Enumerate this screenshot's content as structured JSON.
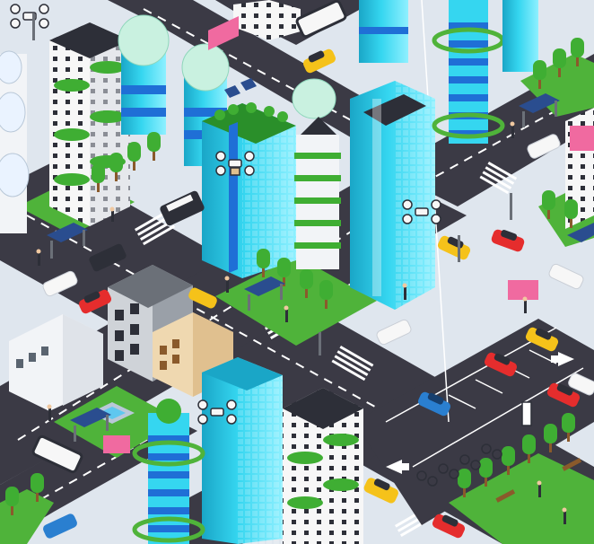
{
  "image": {
    "kind": "isometric smart-city illustration",
    "texts": []
  },
  "palette": {
    "road": "#3b3a45",
    "road_edge": "#2c2b34",
    "sidewalk": "#dfe6ee",
    "lane_mark": "#ffffff",
    "grass": "#4fb33a",
    "grass_dark": "#3a8f2b",
    "glass_cyan": "#35d6f0",
    "glass_cyan_dark": "#1aa6c7",
    "glass_cyan_light": "#8ff0ff",
    "stripe_blue": "#1f6fd6",
    "white_wall": "#f2f4f7",
    "grey_wall": "#9aa0a8",
    "beige_wall": "#efd8b0",
    "car_red": "#e52d2d",
    "car_yellow": "#f5c21a",
    "car_white": "#f7f7f7",
    "car_blue": "#2a7fd0",
    "bus": "#2d2f38",
    "tree": "#3fae33",
    "trunk": "#8a5a2b",
    "solar": "#2a4d8f",
    "billboard": "#f06aa0"
  }
}
